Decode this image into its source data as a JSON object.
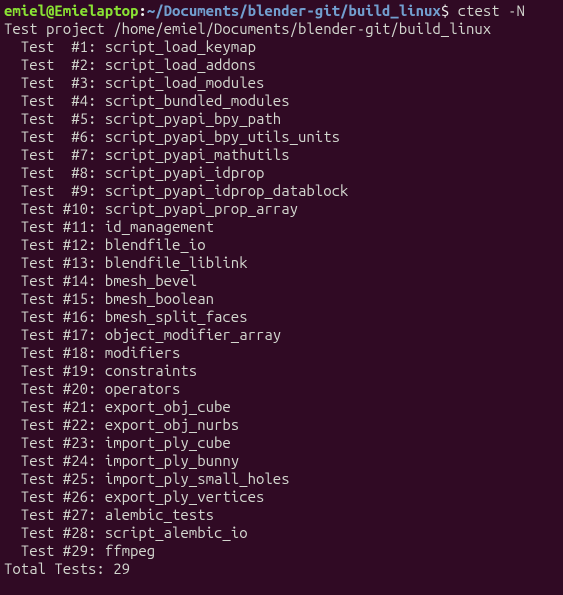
{
  "prompt": {
    "user": "emiel@Emielaptop",
    "sep1": ":",
    "path": "~/Documents/blender-git/build_linux",
    "sep2": "$ ",
    "command": "ctest -N"
  },
  "project_line": "Test project /home/emiel/Documents/blender-git/build_linux",
  "tests": [
    {
      "num": "#1",
      "name": "script_load_keymap"
    },
    {
      "num": "#2",
      "name": "script_load_addons"
    },
    {
      "num": "#3",
      "name": "script_load_modules"
    },
    {
      "num": "#4",
      "name": "script_bundled_modules"
    },
    {
      "num": "#5",
      "name": "script_pyapi_bpy_path"
    },
    {
      "num": "#6",
      "name": "script_pyapi_bpy_utils_units"
    },
    {
      "num": "#7",
      "name": "script_pyapi_mathutils"
    },
    {
      "num": "#8",
      "name": "script_pyapi_idprop"
    },
    {
      "num": "#9",
      "name": "script_pyapi_idprop_datablock"
    },
    {
      "num": "#10",
      "name": "script_pyapi_prop_array"
    },
    {
      "num": "#11",
      "name": "id_management"
    },
    {
      "num": "#12",
      "name": "blendfile_io"
    },
    {
      "num": "#13",
      "name": "blendfile_liblink"
    },
    {
      "num": "#14",
      "name": "bmesh_bevel"
    },
    {
      "num": "#15",
      "name": "bmesh_boolean"
    },
    {
      "num": "#16",
      "name": "bmesh_split_faces"
    },
    {
      "num": "#17",
      "name": "object_modifier_array"
    },
    {
      "num": "#18",
      "name": "modifiers"
    },
    {
      "num": "#19",
      "name": "constraints"
    },
    {
      "num": "#20",
      "name": "operators"
    },
    {
      "num": "#21",
      "name": "export_obj_cube"
    },
    {
      "num": "#22",
      "name": "export_obj_nurbs"
    },
    {
      "num": "#23",
      "name": "import_ply_cube"
    },
    {
      "num": "#24",
      "name": "import_ply_bunny"
    },
    {
      "num": "#25",
      "name": "import_ply_small_holes"
    },
    {
      "num": "#26",
      "name": "export_ply_vertices"
    },
    {
      "num": "#27",
      "name": "alembic_tests"
    },
    {
      "num": "#28",
      "name": "script_alembic_io"
    },
    {
      "num": "#29",
      "name": "ffmpeg"
    }
  ],
  "footer_blank": "",
  "footer_total": "Total Tests: 29"
}
